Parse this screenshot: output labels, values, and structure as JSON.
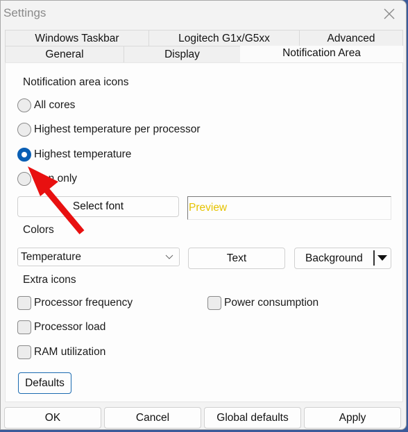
{
  "window": {
    "title": "Settings",
    "close_icon": "close-icon"
  },
  "tabs": {
    "top_row": [
      {
        "label": "Windows Taskbar",
        "active": false
      },
      {
        "label": "Logitech G1x/G5xx",
        "active": false
      },
      {
        "label": "Advanced",
        "active": false
      }
    ],
    "bottom_row": [
      {
        "label": "General",
        "active": false
      },
      {
        "label": "Display",
        "active": false
      },
      {
        "label": "Notification Area",
        "active": true
      }
    ]
  },
  "notification_icons": {
    "heading": "Notification area icons",
    "options": [
      {
        "label": "All cores",
        "checked": false
      },
      {
        "label": "Highest temperature per processor",
        "checked": false
      },
      {
        "label": "Highest temperature",
        "checked": true
      },
      {
        "label": "Icon only",
        "checked": false
      }
    ],
    "select_font_label": "Select font",
    "preview_text": "Preview",
    "preview_color": "#e6c300"
  },
  "colors": {
    "heading": "Colors",
    "combo_value": "Temperature",
    "text_button": "Text",
    "background_button": "Background"
  },
  "extra_icons": {
    "heading": "Extra icons",
    "checkboxes": [
      {
        "label": "Processor frequency",
        "checked": false
      },
      {
        "label": "Power consumption",
        "checked": false
      },
      {
        "label": "Processor load",
        "checked": false
      },
      {
        "label": "RAM utilization",
        "checked": false
      }
    ],
    "defaults_button": "Defaults"
  },
  "footer": {
    "ok": "OK",
    "cancel": "Cancel",
    "global_defaults": "Global defaults",
    "apply": "Apply"
  },
  "annotation": {
    "type": "red-arrow",
    "points_to": "Highest temperature",
    "color": "#e81010"
  },
  "accent_color": "#0a5fb4"
}
